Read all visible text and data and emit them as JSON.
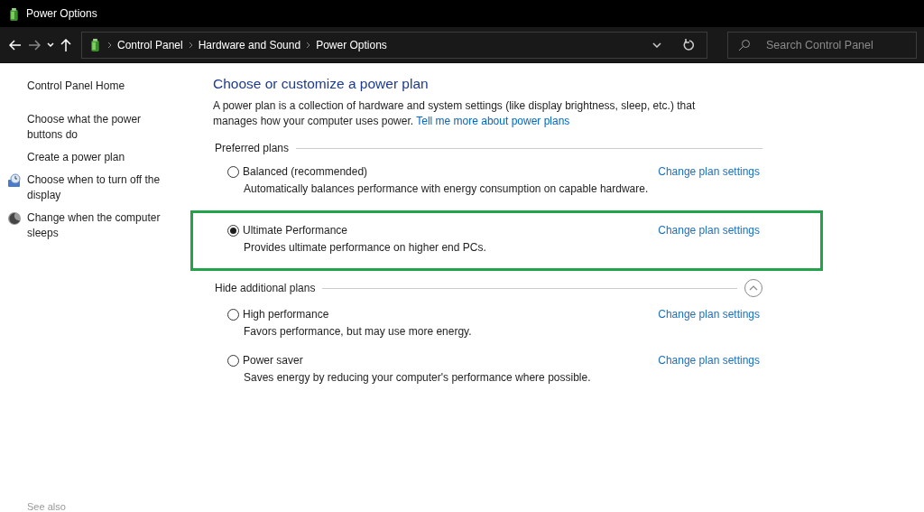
{
  "window": {
    "title": "Power Options"
  },
  "address_bar": {
    "breadcrumbs": [
      "Control Panel",
      "Hardware and Sound",
      "Power Options"
    ]
  },
  "search": {
    "placeholder": "Search Control Panel"
  },
  "sidebar": {
    "items": [
      {
        "label": "Control Panel Home",
        "kind": "home"
      },
      {
        "label": "Choose what the power buttons do",
        "kind": "plain"
      },
      {
        "label": "Create a power plan",
        "kind": "plain"
      },
      {
        "label": "Choose when to turn off the display",
        "kind": "display"
      },
      {
        "label": "Change when the computer sleeps",
        "kind": "sleep"
      }
    ],
    "see_also": "See also"
  },
  "heading": "Choose or customize a power plan",
  "intro": "A power plan is a collection of hardware and system settings (like display brightness, sleep, etc.) that manages how your computer uses power.",
  "intro_link": "Tell me more about power plans",
  "groups": [
    {
      "title": "Preferred plans",
      "plans": [
        {
          "name": "Balanced (recommended)",
          "description": "Automatically balances performance with energy consumption on capable hardware.",
          "link": "Change plan settings",
          "selected": false,
          "highlighted": false
        },
        {
          "name": "Ultimate Performance",
          "description": "Provides ultimate performance on higher end PCs.",
          "link": "Change plan settings",
          "selected": true,
          "highlighted": true
        }
      ]
    },
    {
      "title": "Hide additional plans",
      "collapse_button": true,
      "plans": [
        {
          "name": "High performance",
          "description": "Favors performance, but may use more energy.",
          "link": "Change plan settings",
          "selected": false,
          "highlighted": false
        },
        {
          "name": "Power saver",
          "description": "Saves energy by reducing your computer's performance where possible.",
          "link": "Change plan settings",
          "selected": false,
          "highlighted": false
        }
      ]
    }
  ]
}
